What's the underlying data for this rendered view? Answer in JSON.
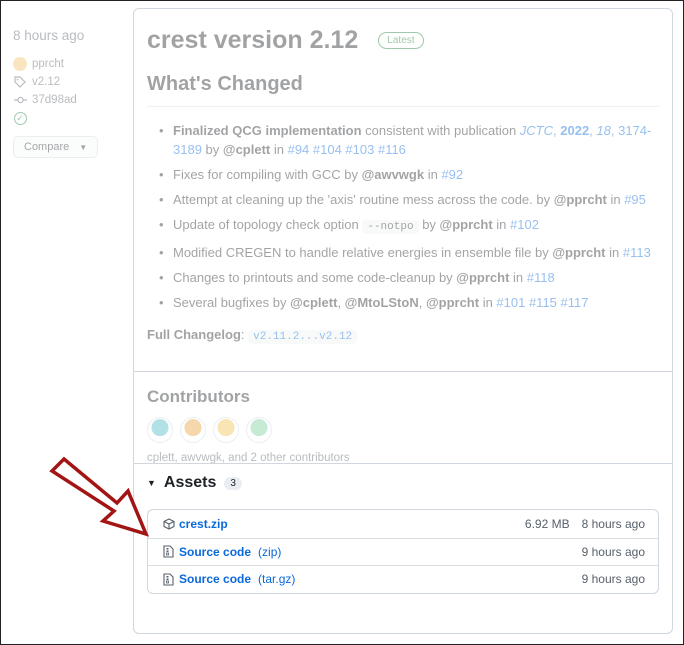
{
  "meta": {
    "time": "8 hours ago",
    "author": "pprcht",
    "tag": "v2.12",
    "commit": "37d98ad",
    "compare_label": "Compare"
  },
  "release": {
    "title": "crest version 2.12",
    "badge": "Latest",
    "whats_changed": "What's Changed",
    "changes": [
      {
        "parts": [
          {
            "t": "Finalized QCG implementation",
            "s": "b"
          },
          {
            "t": " consistent with publication "
          },
          {
            "t": "JCTC",
            "s": "lnk i"
          },
          {
            "t": ", ",
            "s": "lnk"
          },
          {
            "t": "2022",
            "s": "lnk b"
          },
          {
            "t": ", ",
            "s": "lnk"
          },
          {
            "t": "18",
            "s": "lnk i"
          },
          {
            "t": ", 3174-3189",
            "s": "lnk"
          },
          {
            "t": " by "
          },
          {
            "t": "@cplett",
            "s": "b"
          },
          {
            "t": " in "
          },
          {
            "t": "#94 #104 #103 #116",
            "s": "lnk"
          }
        ]
      },
      {
        "parts": [
          {
            "t": "Fixes for compiling with GCC by "
          },
          {
            "t": "@awvwgk",
            "s": "b"
          },
          {
            "t": " in "
          },
          {
            "t": "#92",
            "s": "lnk"
          }
        ]
      },
      {
        "parts": [
          {
            "t": "Attempt at cleaning up the 'axis' routine mess across the code. by "
          },
          {
            "t": "@pprcht",
            "s": "b"
          },
          {
            "t": " in "
          },
          {
            "t": "#95",
            "s": "lnk"
          }
        ]
      },
      {
        "parts": [
          {
            "t": "Update of topology check option "
          },
          {
            "t": "--notpo",
            "s": "code"
          },
          {
            "t": " by "
          },
          {
            "t": "@pprcht",
            "s": "b"
          },
          {
            "t": " in "
          },
          {
            "t": "#102",
            "s": "lnk"
          }
        ]
      },
      {
        "parts": [
          {
            "t": "Modified CREGEN to handle relative energies in ensemble file by "
          },
          {
            "t": "@pprcht",
            "s": "b"
          },
          {
            "t": " in "
          },
          {
            "t": "#113",
            "s": "lnk"
          }
        ]
      },
      {
        "parts": [
          {
            "t": "Changes to printouts and some code-cleanup by "
          },
          {
            "t": "@pprcht",
            "s": "b"
          },
          {
            "t": " in "
          },
          {
            "t": "#118",
            "s": "lnk"
          }
        ]
      },
      {
        "parts": [
          {
            "t": "Several bugfixes by "
          },
          {
            "t": "@cplett",
            "s": "b"
          },
          {
            "t": ", "
          },
          {
            "t": "@MtoLStoN",
            "s": "b"
          },
          {
            "t": ", "
          },
          {
            "t": "@pprcht",
            "s": "b"
          },
          {
            "t": " in "
          },
          {
            "t": "#101 #115 #117",
            "s": "lnk"
          }
        ]
      }
    ],
    "changelog_label": "Full Changelog",
    "changelog_sep": ": ",
    "changelog_range": "v2.11.2...v2.12"
  },
  "contributors": {
    "heading": "Contributors",
    "names": "cplett, awvwgk, and 2 other contributors",
    "avatar_colors": [
      "#4ab8c8",
      "#e8a13a",
      "#f2c14e",
      "#7ccf9a"
    ]
  },
  "assets": {
    "heading": "Assets",
    "count": "3",
    "items": [
      {
        "name": "crest.zip",
        "ext": "",
        "size": "6.92 MB",
        "when": "8 hours ago",
        "icon": "package-icon"
      },
      {
        "name": "Source code",
        "ext": "(zip)",
        "size": "",
        "when": "9 hours ago",
        "icon": "file-zip-icon"
      },
      {
        "name": "Source code",
        "ext": "(tar.gz)",
        "size": "",
        "when": "9 hours ago",
        "icon": "file-zip-icon"
      }
    ]
  },
  "colors": {
    "link": "#0969da",
    "success": "#1a7f37",
    "arrow_stroke": "#a31515"
  }
}
